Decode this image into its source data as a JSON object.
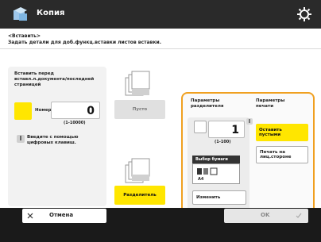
{
  "header": {
    "title": "Копия"
  },
  "subheader": {
    "line1": "<Вставить>",
    "line2": "Задать детали для доб.функц.вставки листов вставки."
  },
  "left": {
    "insert_label_lines": [
      "Вставить перед",
      "вставл.л.документа/последней",
      "страницей"
    ],
    "page_no_label": "Номер стр.",
    "page_value": "0",
    "range": "(1-10000)",
    "ten_key_hint_lines": [
      "Введите с помощью",
      "цифровых клавиш."
    ]
  },
  "middle": {
    "blank_label": "Пусто",
    "divider_label": "Разделитель"
  },
  "right": {
    "divider_params_label": [
      "Параметры",
      "разделителя"
    ],
    "print_params_label": [
      "Параметры",
      "печати"
    ],
    "divider_value": "1",
    "divider_range": "(1-100)",
    "paper_select_label": "Выбор бумаги",
    "paper_size": "A4",
    "change_label": "Изменить",
    "leave_blank_label": [
      "Оставить",
      "пустыми"
    ],
    "print_front_label": [
      "Печать на",
      "лиц.стороне"
    ]
  },
  "footer": {
    "cancel_label": "Отмена",
    "ok_label": "OK"
  },
  "colors": {
    "accent_yellow": "#ffe600",
    "orange_border": "#f0a020"
  },
  "icons": [
    "copy-app-icon",
    "gear-icon",
    "document-icon",
    "finger-icon",
    "close-icon",
    "check-icon",
    "divider-docs-icon"
  ]
}
